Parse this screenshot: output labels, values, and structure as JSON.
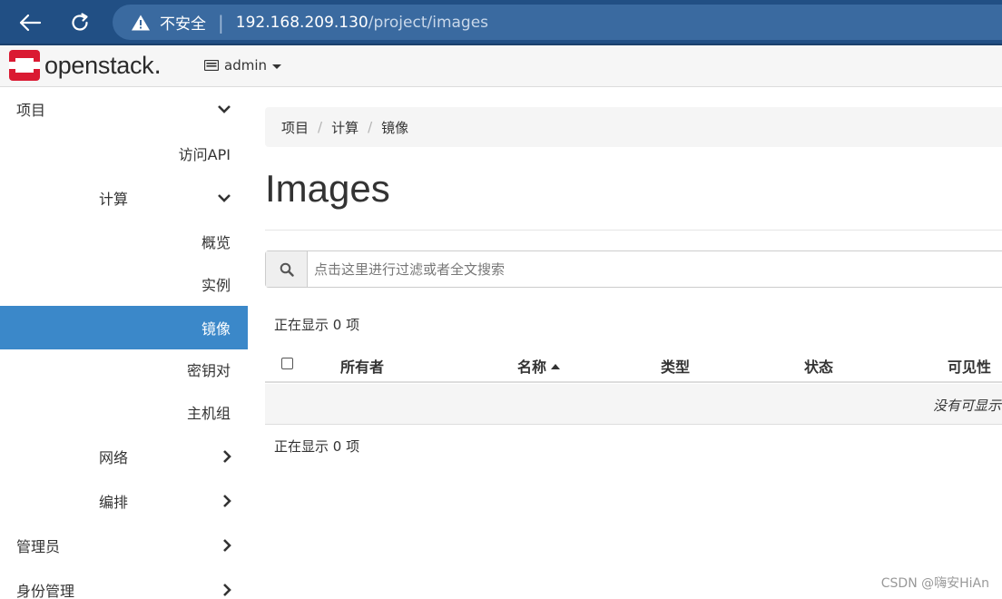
{
  "browser": {
    "security_label": "不安全",
    "url_host": "192.168.209.130",
    "url_path": "/project/images"
  },
  "header": {
    "logo_text": "openstack",
    "project_name": "admin"
  },
  "sidebar": {
    "items": [
      {
        "label": "项目",
        "expanded": true
      },
      {
        "label": "访问API"
      },
      {
        "label": "计算",
        "expanded": true
      },
      {
        "label": "概览"
      },
      {
        "label": "实例"
      },
      {
        "label": "镜像",
        "active": true
      },
      {
        "label": "密钥对"
      },
      {
        "label": "主机组"
      },
      {
        "label": "网络",
        "expanded": false
      },
      {
        "label": "编排",
        "expanded": false
      },
      {
        "label": "管理员",
        "expanded": false
      },
      {
        "label": "身份管理",
        "expanded": false
      }
    ]
  },
  "breadcrumb": [
    "项目",
    "计算",
    "镜像"
  ],
  "page": {
    "title": "Images"
  },
  "search": {
    "placeholder": "点击这里进行过滤或者全文搜索",
    "value": ""
  },
  "table": {
    "count_text": "正在显示 0 项",
    "columns": [
      "所有者",
      "名称",
      "类型",
      "状态",
      "可见性"
    ],
    "sorted_column": "名称",
    "sort_direction": "ascending",
    "empty_text": "没有可显示"
  },
  "watermark": "CSDN @嗨安HiAn",
  "colors": {
    "browser_bar": "#214f84",
    "active_nav": "#3b88c9",
    "logo_red": "#da1a32"
  }
}
